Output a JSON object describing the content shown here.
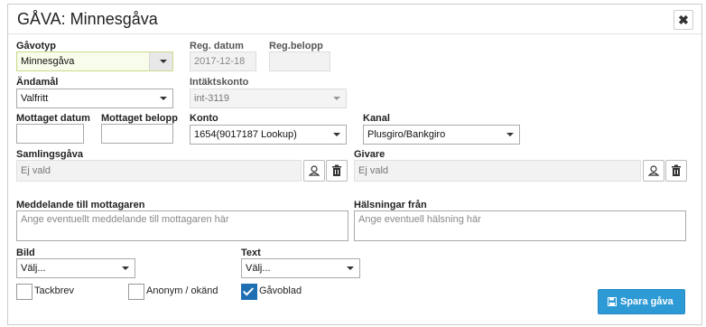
{
  "dialog": {
    "title": "GÅVA: Minnesgåva",
    "close_glyph": "✖"
  },
  "fields": {
    "gavotyp": {
      "label": "Gåvotyp",
      "value": "Minnesgåva"
    },
    "reg_datum": {
      "label": "Reg. datum",
      "value": "2017-12-18"
    },
    "reg_belopp": {
      "label": "Reg.belopp",
      "value": ""
    },
    "andamal": {
      "label": "Ändamål",
      "value": "Valfritt"
    },
    "intaktskonto": {
      "label": "Intäktskonto",
      "value": "int-3119"
    },
    "mottaget_datum": {
      "label": "Mottaget datum",
      "value": ""
    },
    "mottaget_belopp": {
      "label": "Mottaget belopp",
      "value": ""
    },
    "konto": {
      "label": "Konto",
      "value": "1654(9017187 Lookup)"
    },
    "kanal": {
      "label": "Kanal",
      "value": "Plusgiro/Bankgiro"
    },
    "samlingsgava": {
      "label": "Samlingsgåva",
      "value": "Ej vald"
    },
    "givare": {
      "label": "Givare",
      "value": "Ej vald"
    },
    "meddelande": {
      "label": "Meddelande till mottagaren",
      "placeholder": "Ange eventuellt meddelande till mottagaren här"
    },
    "halsningar": {
      "label": "Hälsningar från",
      "placeholder": "Ange eventuell hälsning här"
    },
    "bild": {
      "label": "Bild",
      "value": "Välj..."
    },
    "text": {
      "label": "Text",
      "value": "Välj..."
    }
  },
  "checkboxes": [
    {
      "label": "Tackbrev",
      "checked": false
    },
    {
      "label": "Anonym / okänd",
      "checked": false
    },
    {
      "label": "Gåvoblad",
      "checked": true
    }
  ],
  "actions": {
    "save_label": "Spara gåva"
  },
  "colors": {
    "primary": "#2d9ad6",
    "checkbox_on": "#1f6fb2",
    "focus_bg": "#f8fcea"
  }
}
